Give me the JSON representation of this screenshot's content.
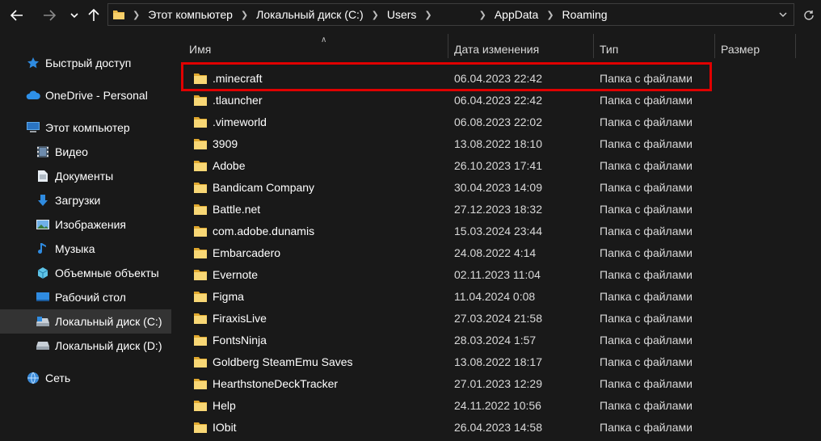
{
  "window": {
    "accent_color": "#e00000",
    "background": "#191919"
  },
  "navigation": {
    "back_icon": "arrow-left-icon",
    "forward_icon": "arrow-right-icon",
    "history_icon": "chevron-down-icon",
    "up_icon": "arrow-up-icon",
    "refresh_icon": "refresh-icon"
  },
  "address_bar": {
    "breadcrumbs": [
      "Этот компьютер",
      "Локальный диск (C:)",
      "Users",
      "",
      "AppData",
      "Roaming"
    ]
  },
  "sidebar": {
    "items": [
      {
        "label": "Быстрый доступ",
        "icon": "star-icon"
      },
      {
        "label": "OneDrive - Personal",
        "icon": "cloud-icon"
      },
      {
        "label": "Этот компьютер",
        "icon": "computer-icon"
      },
      {
        "label": "Видео",
        "icon": "video-icon"
      },
      {
        "label": "Документы",
        "icon": "document-icon"
      },
      {
        "label": "Загрузки",
        "icon": "download-icon"
      },
      {
        "label": "Изображения",
        "icon": "image-icon"
      },
      {
        "label": "Музыка",
        "icon": "music-icon"
      },
      {
        "label": "Объемные объекты",
        "icon": "cube-icon"
      },
      {
        "label": "Рабочий стол",
        "icon": "desktop-icon"
      },
      {
        "label": "Локальный диск (C:)",
        "icon": "drive-icon",
        "selected": true
      },
      {
        "label": "Локальный диск (D:)",
        "icon": "drive-icon"
      },
      {
        "label": "Сеть",
        "icon": "network-icon"
      }
    ]
  },
  "file_list": {
    "columns": {
      "name": "Имя",
      "date": "Дата изменения",
      "type": "Тип",
      "size": "Размер"
    },
    "rows": [
      {
        "name": ".minecraft",
        "date": "06.04.2023 22:42",
        "type": "Папка с файлами",
        "highlighted": true
      },
      {
        "name": ".tlauncher",
        "date": "06.04.2023 22:42",
        "type": "Папка с файлами"
      },
      {
        "name": ".vimeworld",
        "date": "06.08.2023 22:02",
        "type": "Папка с файлами"
      },
      {
        "name": "3909",
        "date": "13.08.2022 18:10",
        "type": "Папка с файлами"
      },
      {
        "name": "Adobe",
        "date": "26.10.2023 17:41",
        "type": "Папка с файлами"
      },
      {
        "name": "Bandicam Company",
        "date": "30.04.2023 14:09",
        "type": "Папка с файлами"
      },
      {
        "name": "Battle.net",
        "date": "27.12.2023 18:32",
        "type": "Папка с файлами"
      },
      {
        "name": "com.adobe.dunamis",
        "date": "15.03.2024 23:44",
        "type": "Папка с файлами"
      },
      {
        "name": "Embarcadero",
        "date": "24.08.2022 4:14",
        "type": "Папка с файлами"
      },
      {
        "name": "Evernote",
        "date": "02.11.2023 11:04",
        "type": "Папка с файлами"
      },
      {
        "name": "Figma",
        "date": "11.04.2024 0:08",
        "type": "Папка с файлами"
      },
      {
        "name": "FiraxisLive",
        "date": "27.03.2024 21:58",
        "type": "Папка с файлами"
      },
      {
        "name": "FontsNinja",
        "date": "28.03.2024 1:57",
        "type": "Папка с файлами"
      },
      {
        "name": "Goldberg SteamEmu Saves",
        "date": "13.08.2022 18:17",
        "type": "Папка с файлами"
      },
      {
        "name": "HearthstoneDeckTracker",
        "date": "27.01.2023 12:29",
        "type": "Папка с файлами"
      },
      {
        "name": "Help",
        "date": "24.11.2022 10:56",
        "type": "Папка с файлами"
      },
      {
        "name": "IObit",
        "date": "26.04.2023 14:58",
        "type": "Папка с файлами"
      }
    ]
  }
}
